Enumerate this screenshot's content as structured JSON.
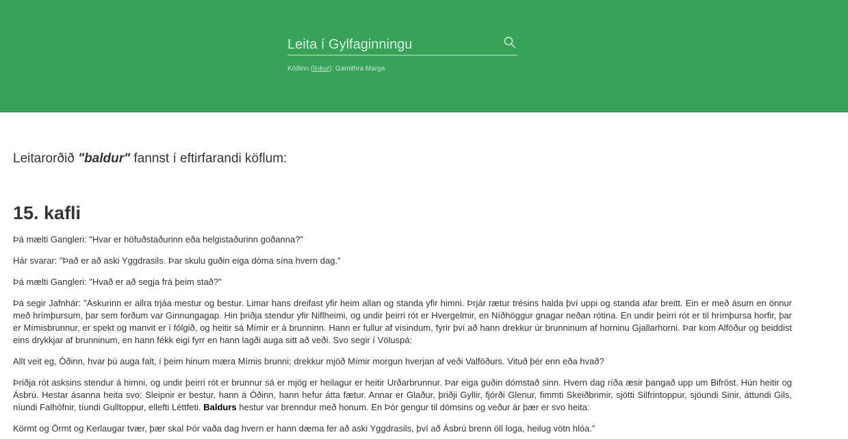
{
  "header": {
    "search": {
      "placeholder": "Leita í Gylfaginningu"
    },
    "credit": {
      "prefix": "Kóðinn (",
      "link_label": "linkur",
      "suffix": "): Gamithra Marga"
    }
  },
  "results": {
    "prefix": "Leitarorðið ",
    "term": "\"baldur\"",
    "suffix": " fannst í eftirfarandi köflum:"
  },
  "chapter": {
    "title": "15. kafli",
    "paragraphs": [
      "Þá mælti Gangleri: \"Hvar er höfuðstaðurinn eða helgistaðurinn goðanna?\"",
      "Hár svarar: \"Það er að aski Yggdrasils. Þar skulu guðin eiga dóma sína hvern dag.\"",
      "Þá mælti Gangleri: \"Hvað er að segja frá þeim stað?\"",
      "Þá segir Jafnhár: \"Askurinn er allra trjáa mestur og bestur. Limar hans dreifast yfir heim allan og standa yfir himni. Þrjár rætur trésins halda því uppi og standa afar breitt. Ein er með ásum en önnur með hrímþursum, þar sem forðum var Ginnungagap. Hin þriðja stendur yfir Niflheimi, og undir þeirri rót er Hvergelmir, en Níðhöggur gnagar neðan rótina. En undir þeirri rót er til hrímþursa horfir, þar er Mímisbrunnur, er spekt og manvit er í fólgið, og heitir sá Mímir er á brunninn. Hann er fullur af vísindum, fyrir því að hann drekkur úr brunninum af horninu Gjallarhorni. Þar kom Alföður og beiddist eins drykkjar af brunninum, en hann fékk eigi fyrr en hann lagði auga sitt að veði. Svo segir í Völuspá:",
      "Allt veit eg, Óðinn, hvar þú auga falt, í þeim hinum mæra Mímis brunni; drekkur mjöð Mímir morgun hverjan af veði Valföðurs. Vituð þér enn eða hvað?"
    ],
    "para6": {
      "before": "Þriðja rót asksins stendur á himni, og undir þeirri rót er brunnur sá er mjög er heilagur er heitir Urðarbrunnur. Þar eiga guðin dómstað sinn. Hvern dag ríða æsir þangað upp um Bifröst. Hún heitir og Ásbrú. Hestar ásanna heita svo: Sleipnir er bestur, hann á Óðinn, hann hefur átta fætur. Annar er Glaður, þriðji Gyllir, fjórði Glenur, fimmti Skeiðbrimir, sjötti Silfrintoppur, sjöundi Sinir, áttundi Gils, níundi Falhófnir, tíundi Gulltoppur, ellefti Léttfeti. ",
      "highlight": "Baldurs",
      "after": " hestur var brenndur með honum. En Þór gengur til dómsins og veður ár þær er svo heita:"
    },
    "para7": "Körmt og Örmt og Kerlaugar tvær, þær skal Þór vaða dag hvern er hann dæma fer að aski Yggdrasils, því að Ásbrú brenn öll loga, heilug vötn hlóa.\""
  },
  "colors": {
    "header_bg": "#36a358",
    "text": "#333333",
    "highlight": "#000000"
  }
}
